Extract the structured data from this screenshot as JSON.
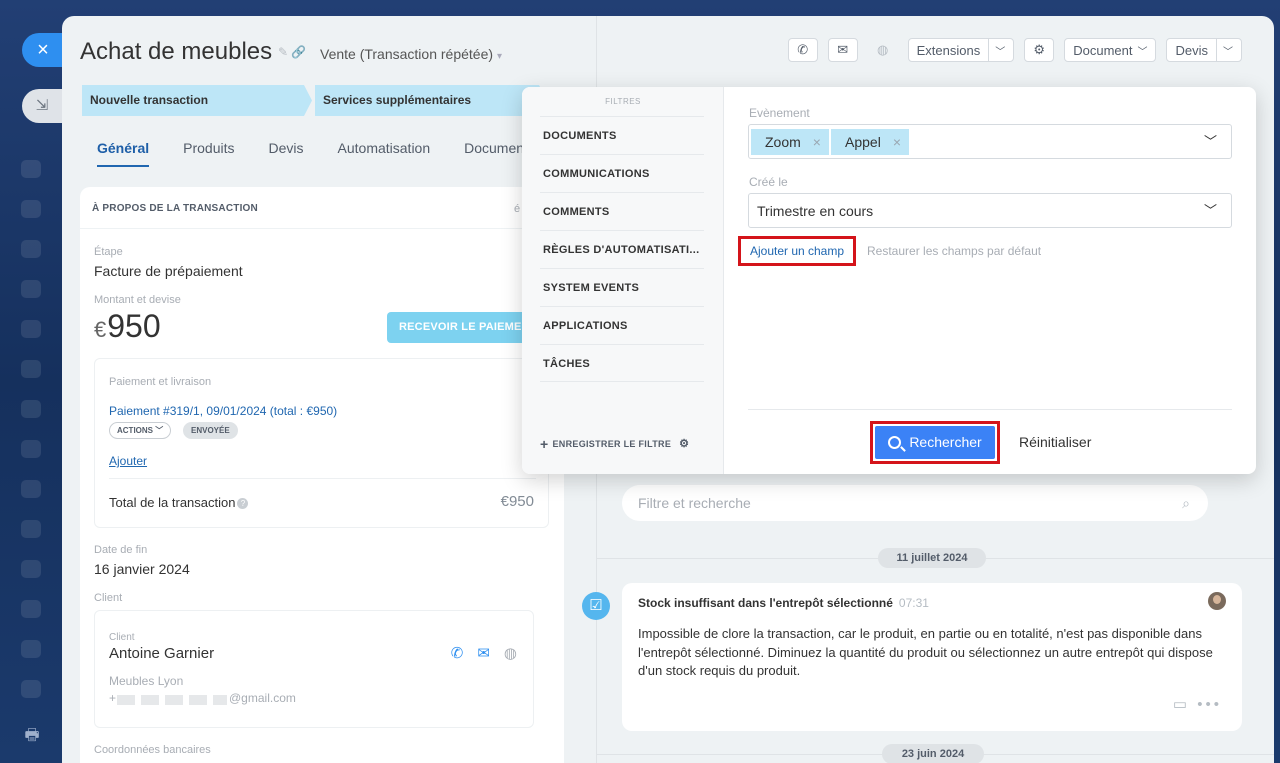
{
  "deal": {
    "title": "Achat de meubles",
    "category": "Vente (Transaction répétée)"
  },
  "toolbar": {
    "extensions": "Extensions",
    "document": "Document",
    "devis": "Devis"
  },
  "stages": [
    "Nouvelle transaction",
    "Services supplémentaires"
  ],
  "tabs": [
    "Général",
    "Produits",
    "Devis",
    "Automatisation",
    "Documents"
  ],
  "about": {
    "header": "À PROPOS DE LA TRANSACTION",
    "header_right": "é",
    "stage_label": "Étape",
    "stage_value": "Facture de prépaiement",
    "amount_label": "Montant et devise",
    "currency": "€",
    "amount": "950",
    "receive_button": "RECEVOIR LE PAIEMENT",
    "payment_section": "Paiement et livraison",
    "payment_link": "Paiement #319/1, 09/01/2024 (total : €950)",
    "actions_pill": "ACTIONS",
    "sent_pill": "ENVOYÉE",
    "add_link": "Ajouter",
    "total_label": "Total de la transaction",
    "total_value": "€950",
    "end_date_label": "Date de fin",
    "end_date": "16 janvier 2024",
    "client_section": "Client",
    "client_label": "Client",
    "client_name": "Antoine Garnier",
    "client_company": "Meubles Lyon",
    "phone_prefix": "+",
    "email_suffix": "@gmail.com",
    "bank_label": "Coordonnées bancaires"
  },
  "timeline": {
    "search_placeholder": "Filtre et recherche",
    "date1": "11 juillet 2024",
    "item_title": "Stock insuffisant dans l'entrepôt sélectionné",
    "item_time": "07:31",
    "item_body": "Impossible de clore la transaction, car le produit, en partie ou en totalité, n'est pas disponible dans l'entrepôt sélectionné. Diminuez la quantité du produit ou sélectionnez un autre entrepôt qui dispose d'un stock requis du produit.",
    "date2": "23 juin 2024"
  },
  "filter": {
    "title": "FILTRES",
    "items": [
      "DOCUMENTS",
      "COMMUNICATIONS",
      "COMMENTS",
      "RÈGLES D'AUTOMATISATI...",
      "SYSTEM EVENTS",
      "APPLICATIONS",
      "TÂCHES"
    ],
    "save_filter": "ENREGISTRER LE FILTRE",
    "event_label": "Evènement",
    "tags": [
      "Zoom",
      "Appel"
    ],
    "created_label": "Créé le",
    "created_value": "Trimestre en cours",
    "add_field": "Ajouter un champ",
    "restore": "Restaurer les champs par défaut",
    "search_button": "Rechercher",
    "reset_button": "Réinitialiser"
  },
  "colors": {
    "accent": "#3b82f6",
    "highlight": "#d4141a",
    "stage": "#bde6f7"
  }
}
